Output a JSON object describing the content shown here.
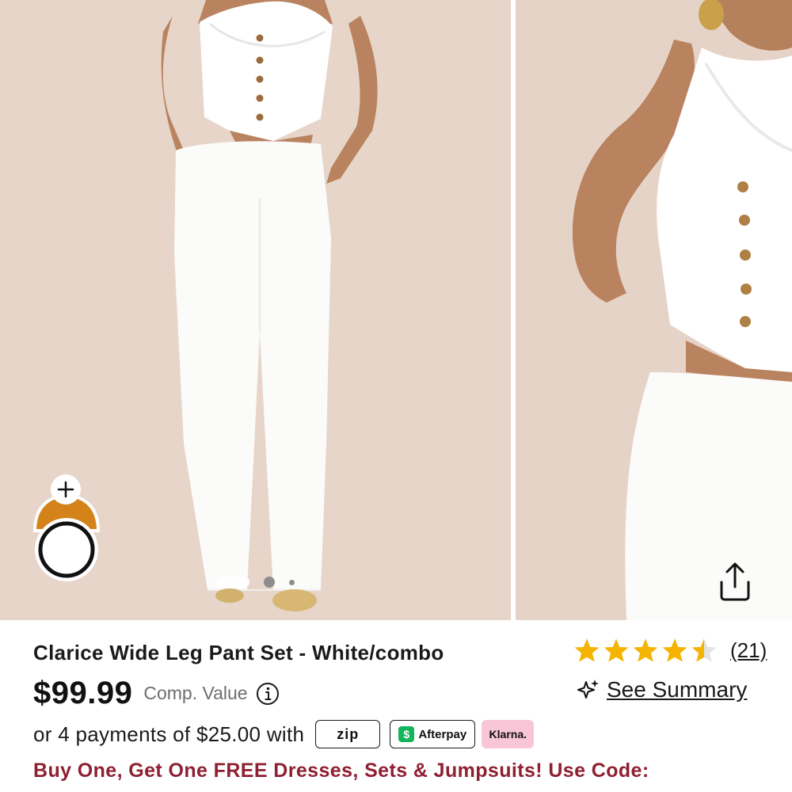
{
  "gallery": {
    "images": [
      {
        "alt": "model-full-length"
      },
      {
        "alt": "model-closeup"
      }
    ],
    "pagination": {
      "total": 3,
      "active": 1
    }
  },
  "product": {
    "title": "Clarice Wide Leg Pant Set - White/combo",
    "price": "$99.99",
    "comp_value_label": "Comp. Value",
    "rating": 4.5,
    "max_rating": 5,
    "review_count": "(21)",
    "summary_label": "See Summary"
  },
  "payment": {
    "text": "or 4 payments of $25.00 with",
    "providers": {
      "zip": "zip",
      "afterpay": "Afterpay",
      "klarna": "Klarna."
    }
  },
  "promo": {
    "text": "Buy One, Get One FREE Dresses, Sets & Jumpsuits! Use Code:"
  },
  "colors": {
    "star": "#f5b400",
    "promo": "#8e2032",
    "photo_bg": "#e7d5c9",
    "klarna_bg": "#f8c6d6",
    "afterpay_green": "#12b65a"
  },
  "icons": {
    "share": "share-icon",
    "info": "info-icon",
    "sparkle": "sparkle-icon",
    "add": "plus-icon"
  }
}
